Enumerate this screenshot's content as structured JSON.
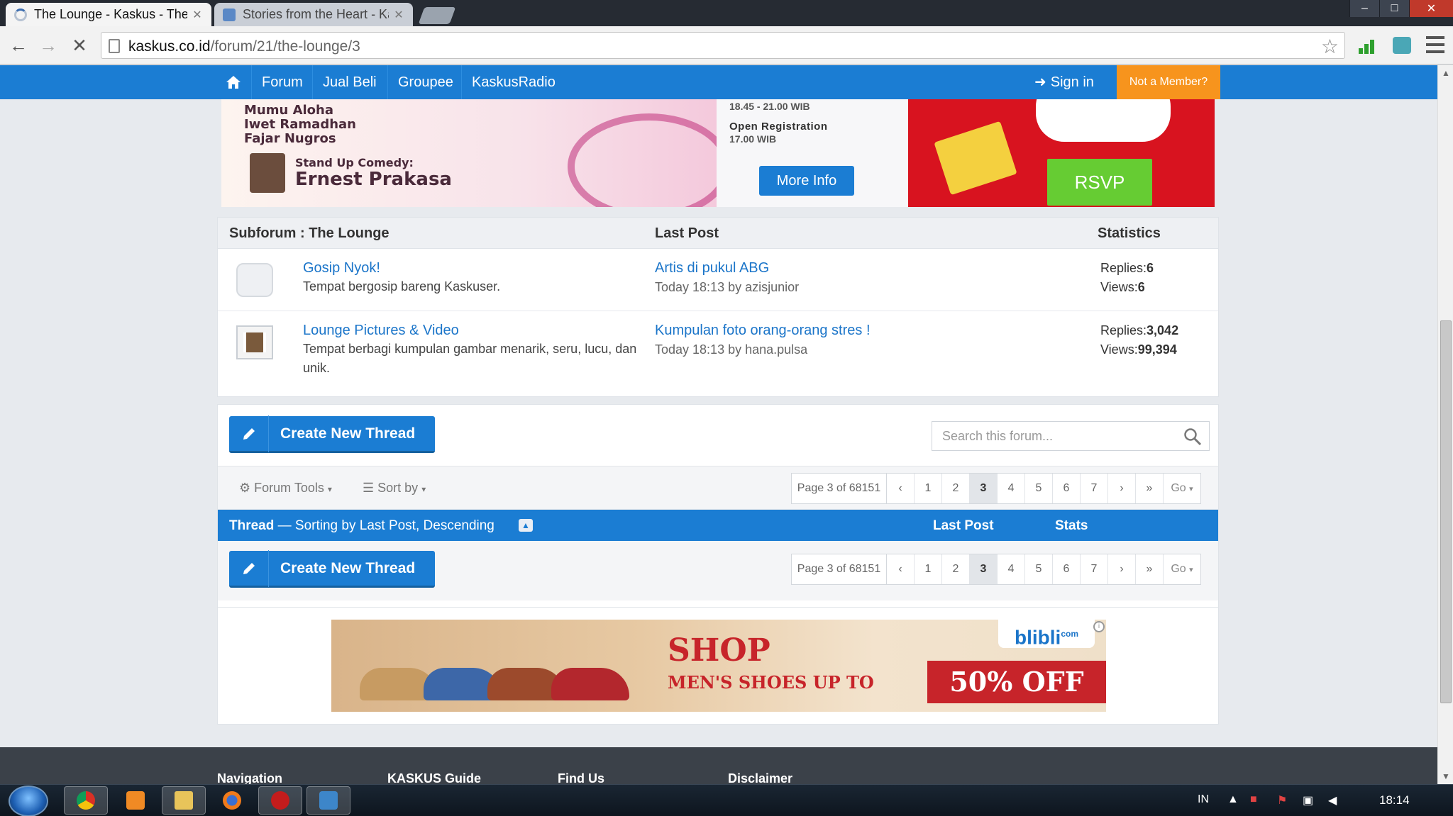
{
  "browser": {
    "tabs": [
      {
        "title": "The Lounge - Kaskus - The",
        "active": true
      },
      {
        "title": "Stories from the Heart - Ka",
        "active": false
      }
    ],
    "url_host": "kaskus.co.id",
    "url_path": "/forum/21/the-lounge/3",
    "window_controls": {
      "minimize": "–",
      "maximize": "□",
      "close": "✕"
    }
  },
  "topnav": {
    "items": [
      "Forum",
      "Jual Beli",
      "Groupee",
      "KaskusRadio"
    ],
    "signin": "Sign in",
    "member": "Not a Member?"
  },
  "banner": {
    "lines": [
      "Mumu Aloha",
      "Iwet Ramadhan",
      "Fajar Nugros"
    ],
    "standup": "Stand Up Comedy:",
    "comedian": "Ernest Prakasa",
    "time": "18.45 - 21.00 WIB",
    "open_reg": "Open Registration",
    "reg_time": "17.00 WIB",
    "more_info": "More Info",
    "rsvp": "RSVP"
  },
  "subforum": {
    "headers": {
      "name": "Subforum : The Lounge",
      "last_post": "Last Post",
      "stats": "Statistics"
    },
    "rows": [
      {
        "name": "Gosip Nyok!",
        "desc": "Tempat bergosip bareng Kaskuser.",
        "last_post": "Artis di pukul ABG",
        "last_meta": "Today 18:13 by azisjunior",
        "replies_label": "Replies:",
        "replies": "6",
        "views_label": "Views:",
        "views": "6"
      },
      {
        "name": "Lounge Pictures & Video",
        "desc": "Tempat berbagi kumpulan gambar menarik, seru, lucu, dan unik.",
        "last_post": "Kumpulan foto orang-orang stres !",
        "last_meta": "Today 18:13 by hana.pulsa",
        "replies_label": "Replies:",
        "replies": "3,042",
        "views_label": "Views:",
        "views": "99,394"
      }
    ]
  },
  "thread": {
    "create": "Create New Thread",
    "search_placeholder": "Search this forum...",
    "forum_tools": "Forum Tools",
    "sort_by": "Sort by",
    "pager": {
      "info": "Page 3 of 68151",
      "pages": [
        "1",
        "2",
        "3",
        "4",
        "5",
        "6",
        "7"
      ],
      "current": "3",
      "go": "Go"
    },
    "sortbar": {
      "thread": "Thread",
      "dash": " — Sorting by ",
      "field": "Last Post",
      "comma": ", ",
      "order": "Descending",
      "col_last_post": "Last Post",
      "col_stats": "Stats"
    }
  },
  "ad": {
    "brand": "blibli",
    "brand_suffix": "com",
    "headline": "SHOP",
    "sub": "MEN'S SHOES UP TO",
    "offer": "50% OFF"
  },
  "footer": {
    "cols": [
      "Navigation",
      "KASKUS Guide",
      "Find Us",
      "Disclaimer"
    ]
  },
  "taskbar": {
    "lang": "IN",
    "time": "18:14"
  },
  "colors": {
    "kaskus_blue": "#1b7dd3",
    "member_orange": "#f7941d",
    "link_blue": "#1b75c9"
  }
}
